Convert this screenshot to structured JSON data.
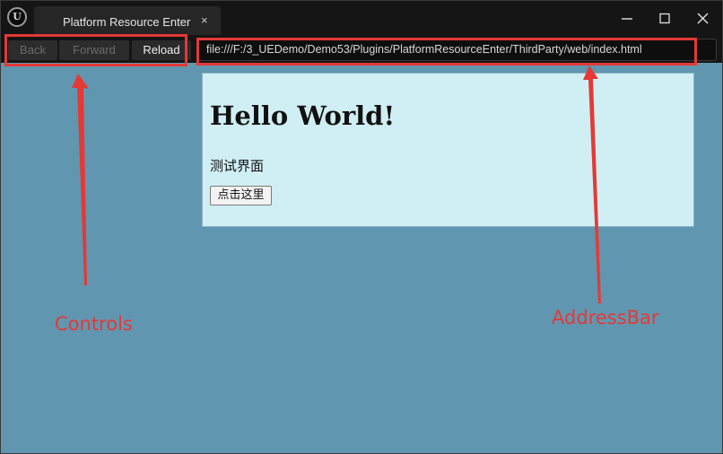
{
  "window": {
    "tab_title": "Platform Resource Enter",
    "tab_close_glyph": "×"
  },
  "toolbar": {
    "back_label": "Back",
    "forward_label": "Forward",
    "reload_label": "Reload",
    "address": "file:///F:/3_UEDemo/Demo53/Plugins/PlatformResourceEnter/ThirdParty/web/index.html"
  },
  "web_page": {
    "heading": "Hello World!",
    "text": "测试界面",
    "button_label": "点击这里"
  },
  "annotations": {
    "controls_label": "Controls",
    "address_bar_label": "AddressBar"
  },
  "colors": {
    "viewport_bg": "#6196b0",
    "page_bg": "#d0eff4",
    "annotation": "#e53935"
  },
  "icons": [
    "unreal-logo-icon",
    "minimize-icon",
    "maximize-icon",
    "close-icon"
  ]
}
